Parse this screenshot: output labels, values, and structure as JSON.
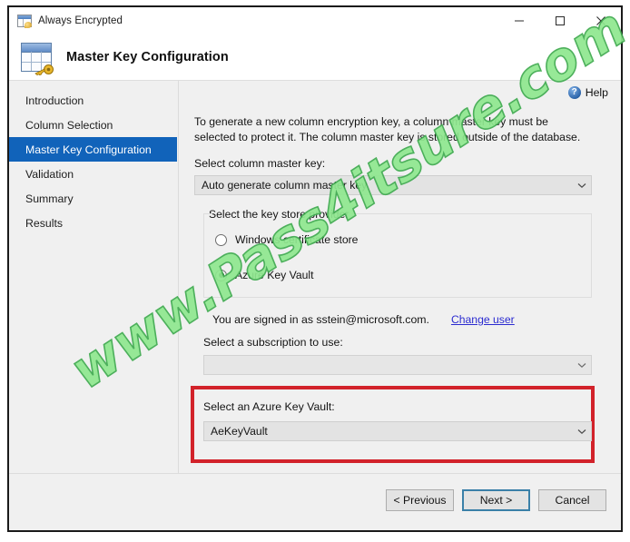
{
  "window": {
    "title": "Always Encrypted",
    "app_icon": "table-key-icon",
    "controls": [
      {
        "name": "minimize",
        "glyph": "minimize-icon"
      },
      {
        "name": "maximize",
        "glyph": "maximize-icon"
      },
      {
        "name": "close",
        "glyph": "close-icon"
      }
    ]
  },
  "header": {
    "title": "Master Key Configuration",
    "icon": "table-key-icon"
  },
  "sidebar": {
    "items": [
      {
        "label": "Introduction",
        "active": false
      },
      {
        "label": "Column Selection",
        "active": false
      },
      {
        "label": "Master Key Configuration",
        "active": true
      },
      {
        "label": "Validation",
        "active": false
      },
      {
        "label": "Summary",
        "active": false
      },
      {
        "label": "Results",
        "active": false
      }
    ],
    "active_bg": "#1163ba",
    "active_fg": "#ffffff"
  },
  "content": {
    "help_label": "Help",
    "intro_text": "To generate a new column encryption key, a column master key must be selected to protect it.  The column master key is stored outside of the database.",
    "cmk_label": "Select column master key:",
    "cmk_value": "Auto generate column master key",
    "provider_group_label": "Select the key store provider",
    "providers": [
      {
        "label": "Windows certificate store",
        "selected": false
      },
      {
        "label": "Azure Key Vault",
        "selected": true
      }
    ],
    "signed_in_text": "You are signed in as sstein@microsoft.com.",
    "change_user_link": "Change user",
    "subscription_label": "Select a subscription to use:",
    "subscription_value": "",
    "keyvault_label": "Select an Azure Key Vault:",
    "keyvault_value": "AeKeyVault",
    "highlight_color": "#d2222a"
  },
  "footer": {
    "buttons": [
      {
        "label": "< Previous",
        "default": false
      },
      {
        "label": "Next >",
        "default": true
      },
      {
        "label": "Cancel",
        "default": false
      }
    ]
  },
  "watermark": {
    "text": "www.Pass4itsure.com",
    "color": "#8fe88f",
    "outline": "#3faa4f"
  }
}
